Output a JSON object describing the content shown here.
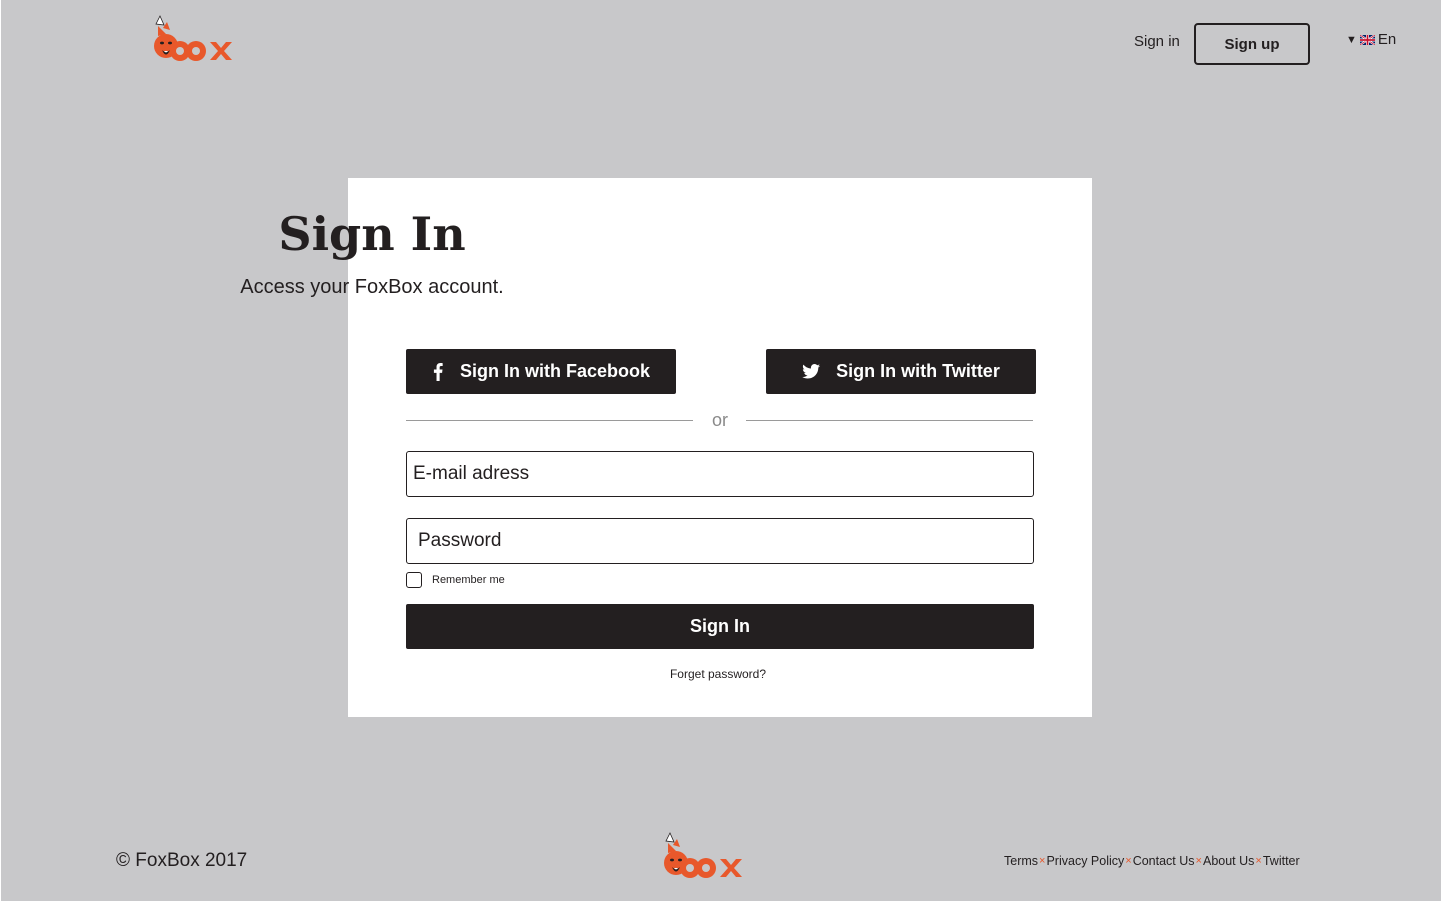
{
  "header": {
    "logo_text": "fox",
    "nav": {
      "signin_label": "Sign in",
      "signup_label": "Sign up"
    },
    "language": {
      "label": "En",
      "caret": "▼",
      "flag_icon": "uk-flag-icon"
    }
  },
  "card": {
    "title": "Sign In",
    "subtitle": "Access your FoxBox account.",
    "facebook_label": "Sign In with Facebook",
    "twitter_label": "Sign In with Twitter",
    "divider_text": "or",
    "email_placeholder": "E-mail adress",
    "password_placeholder": "Password",
    "remember_label": "Remember me",
    "remember_checked": false,
    "submit_label": "Sign In",
    "forgot_label": "Forget password?"
  },
  "footer": {
    "copyright": "© FoxBox 2017",
    "links": [
      "Terms",
      "Privacy Policy",
      "Contact Us",
      "About Us",
      "Twitter"
    ],
    "separator": "×"
  },
  "colors": {
    "background": "#c8c8ca",
    "card": "#ffffff",
    "dark": "#231f20",
    "brand_orange": "#e8582b"
  }
}
